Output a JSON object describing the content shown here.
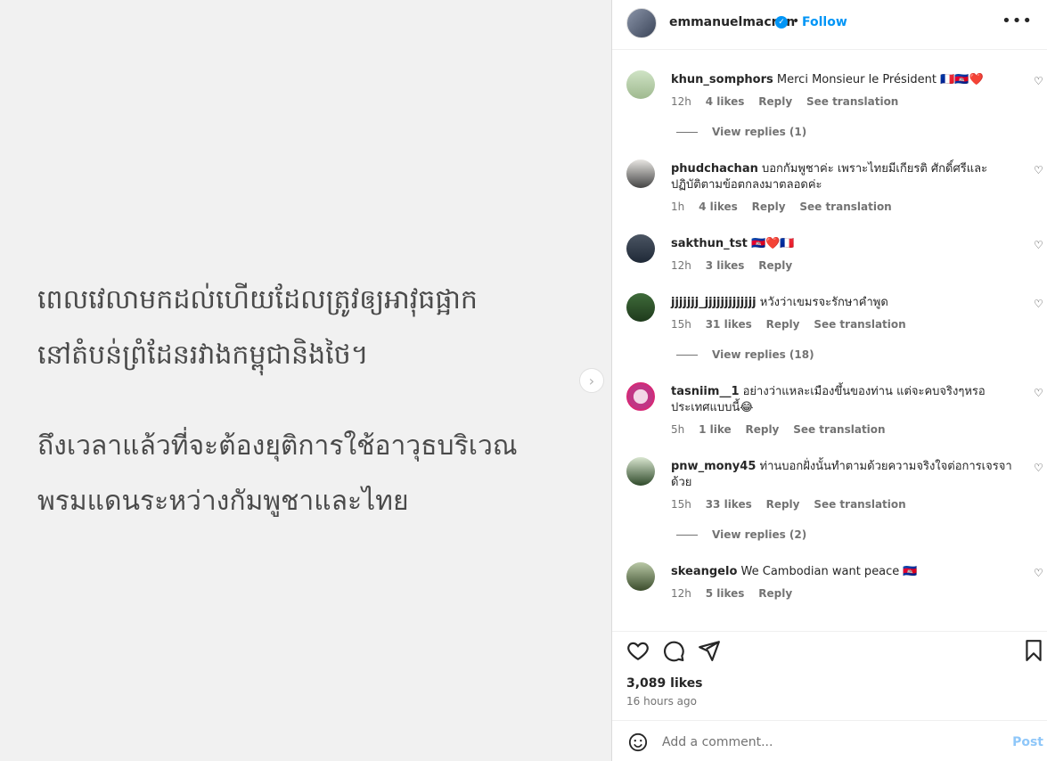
{
  "media": {
    "khmer_text": "ពេលវេលាមកដល់ហើយដែលត្រូវឲ្យអាវុធផ្អាក\nនៅតំបន់ព្រំដែនរវាងកម្ពុជានិងថៃ។",
    "thai_text": "ถึงเวลาแล้วที่จะต้องยุติการใช้อาวุธบริเวณ\nพรมแดนระหว่างกัมพูชาและไทย"
  },
  "header": {
    "username": "emmanuelmacron",
    "separator": "•",
    "follow_label": "Follow",
    "more_icon": "more-options-icon"
  },
  "comments": [
    {
      "username": "khun_somphors",
      "text": "Merci Monsieur le Président 🇫🇷🇰🇭❤️",
      "time": "12h",
      "likes": "4 likes",
      "reply": "Reply",
      "translate": "See translation",
      "view_replies": "View replies (1)"
    },
    {
      "username": "phudchachan",
      "text": "บอกกัมพูชาค่ะ เพราะไทยมีเกียรติ ศักดิ์ศรีและปฏิบัติตามข้อตกลงมาตลอดค่ะ",
      "time": "1h",
      "likes": "4 likes",
      "reply": "Reply",
      "translate": "See translation"
    },
    {
      "username": "sakthun_tst",
      "text": "🇰🇭❤️🇫🇷",
      "time": "12h",
      "likes": "3 likes",
      "reply": "Reply"
    },
    {
      "username": "jjjjjjj_jjjjjjjjjjjjj",
      "text": "หวังว่าเขมรจะรักษาคำพูด",
      "time": "15h",
      "likes": "31 likes",
      "reply": "Reply",
      "translate": "See translation",
      "view_replies": "View replies (18)"
    },
    {
      "username": "tasniim__1",
      "text": "อย่างว่าแหละเมืองขึ้นของท่าน แต่จะคบจริงๆหรอ ประเทศแบบนี้😂",
      "time": "5h",
      "likes": "1 like",
      "reply": "Reply",
      "translate": "See translation"
    },
    {
      "username": "pnw_mony45",
      "text": "ท่านบอกฝั่งนั้นทำตามด้วยความจริงใจต่อการเจรจาด้วย",
      "time": "15h",
      "likes": "33 likes",
      "reply": "Reply",
      "translate": "See translation",
      "view_replies": "View replies (2)"
    },
    {
      "username": "skeangelo",
      "text": "We Cambodian want peace 🇰🇭",
      "time": "12h",
      "likes": "5 likes",
      "reply": "Reply"
    }
  ],
  "actions": {
    "likes": "3,089 likes",
    "time_ago": "16 hours ago"
  },
  "add_comment": {
    "placeholder": "Add a comment...",
    "post_label": "Post"
  },
  "colors": {
    "accent": "#0095f6",
    "muted": "#737373",
    "border": "#dbdbdb"
  }
}
